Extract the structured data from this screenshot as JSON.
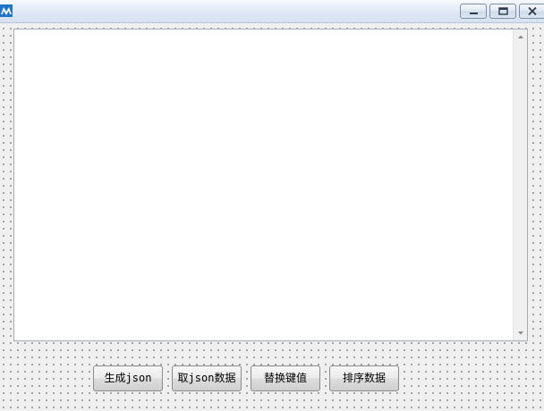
{
  "window": {
    "icon": "app-logo-icon",
    "controls": [
      "minimize-icon",
      "maximize-icon",
      "close-icon"
    ]
  },
  "editor": {
    "value": "",
    "scrollbar": [
      "scroll-up-arrow-icon",
      "scroll-down-arrow-icon"
    ]
  },
  "buttons": {
    "generate_json": "生成json",
    "fetch_json": "取json数据",
    "replace_key_value": "替换键值",
    "sort_data": "排序数据"
  },
  "colors": {
    "title_bar": "#dbe5f2",
    "app_icon": "#1e74c8",
    "dialog_background": "#f0f0f0",
    "editor_background": "#ffffff"
  }
}
